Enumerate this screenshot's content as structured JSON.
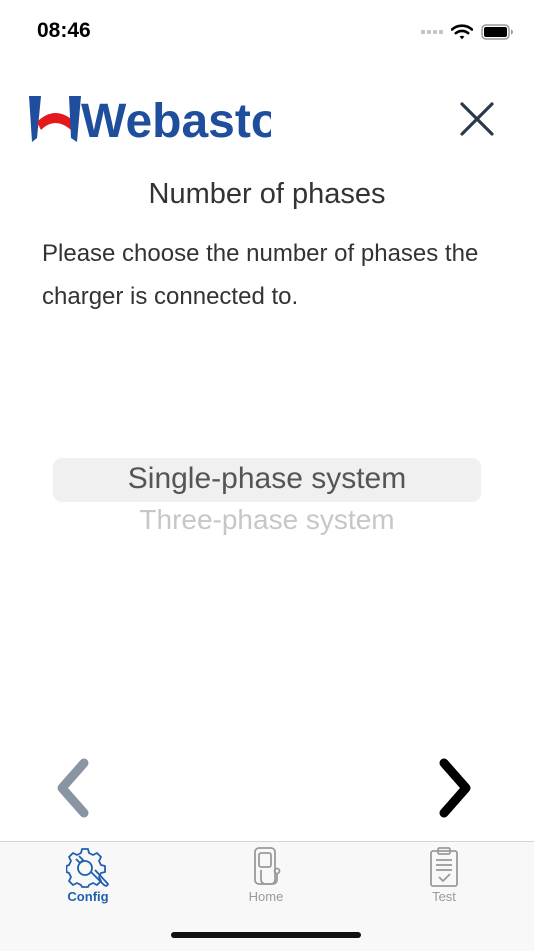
{
  "status_bar": {
    "time": "08:46"
  },
  "brand": {
    "logo_text": "Webasto",
    "logo_color": "#1f4e9c",
    "logo_accent": "#e3191b"
  },
  "page": {
    "title": "Number of phases",
    "description": "Please choose the number of phases the charger is connected to."
  },
  "picker": {
    "options": [
      "Single-phase system",
      "Three-phase system"
    ],
    "selected": "Single-phase system"
  },
  "tabs": [
    {
      "label": "Config",
      "icon": "gear-wrench-icon",
      "active": true
    },
    {
      "label": "Home",
      "icon": "charger-icon",
      "active": false
    },
    {
      "label": "Test",
      "icon": "clipboard-check-icon",
      "active": false
    }
  ],
  "colors": {
    "active_tab": "#1f5fae",
    "inactive_tab": "#9a9a9a"
  }
}
